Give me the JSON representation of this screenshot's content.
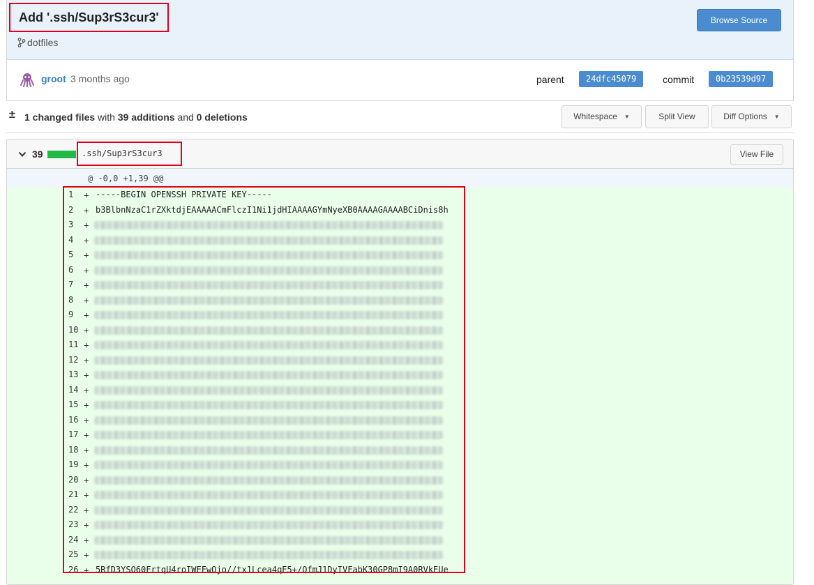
{
  "commit": {
    "title": "Add '.ssh/Sup3rS3cur3'",
    "branch": "dotfiles",
    "browse_label": "Browse Source",
    "author": "groot",
    "time": "3 months ago",
    "parent_label": "parent",
    "parent_sha": "24dfc45079",
    "commit_label": "commit",
    "commit_sha": "0b23539d97"
  },
  "stats": {
    "toggle": "±",
    "changed": "1 changed files",
    "with": "with",
    "additions": "39 additions",
    "and": "and",
    "deletions": "0 deletions",
    "whitespace_label": "Whitespace",
    "split_label": "Split View",
    "diff_options_label": "Diff Options"
  },
  "file": {
    "count": "39",
    "name": ".ssh/Sup3rS3cur3",
    "view_file_label": "View File",
    "hunk_header": "@ -0,0 +1,39 @@",
    "lines": [
      {
        "n": "1",
        "text": "-----BEGIN OPENSSH PRIVATE KEY-----"
      },
      {
        "n": "2",
        "text": "b3BlbnNzaC1rZXktdjEAAAAACmFlczI1Ni1jdHIAAAAGYmNyeXB0AAAAGAAAABCiDnis8h"
      },
      {
        "n": "3",
        "text": ""
      },
      {
        "n": "4",
        "text": ""
      },
      {
        "n": "5",
        "text": ""
      },
      {
        "n": "6",
        "text": ""
      },
      {
        "n": "7",
        "text": ""
      },
      {
        "n": "8",
        "text": ""
      },
      {
        "n": "9",
        "text": ""
      },
      {
        "n": "10",
        "text": ""
      },
      {
        "n": "11",
        "text": ""
      },
      {
        "n": "12",
        "text": ""
      },
      {
        "n": "13",
        "text": ""
      },
      {
        "n": "14",
        "text": ""
      },
      {
        "n": "15",
        "text": ""
      },
      {
        "n": "16",
        "text": ""
      },
      {
        "n": "17",
        "text": ""
      },
      {
        "n": "18",
        "text": ""
      },
      {
        "n": "19",
        "text": ""
      },
      {
        "n": "20",
        "text": ""
      },
      {
        "n": "21",
        "text": ""
      },
      {
        "n": "22",
        "text": ""
      },
      {
        "n": "23",
        "text": ""
      },
      {
        "n": "24",
        "text": ""
      },
      {
        "n": "25",
        "text": ""
      },
      {
        "n": "26",
        "text": "5RfD3YSO60FrtqU4roIWEFwOjo//tx1Lcea4qE5+/QfmJ1DyIVFabK30GP8mI9A0RVkEUe"
      }
    ]
  }
}
